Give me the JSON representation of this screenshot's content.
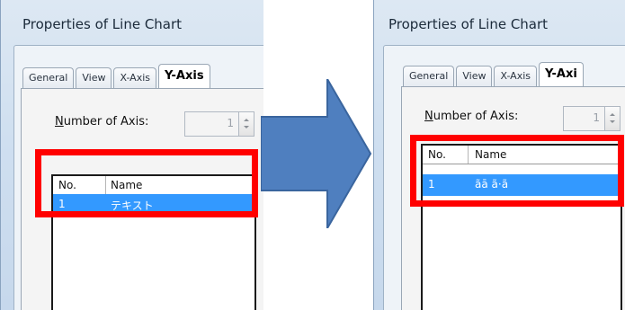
{
  "left_panel": {
    "title": "Properties of Line Chart",
    "tabs": [
      {
        "label": "General"
      },
      {
        "label": "View"
      },
      {
        "label": "X-Axis"
      },
      {
        "label": "Y-Axis"
      }
    ],
    "axis_label_prefix": "",
    "axis_label_mnemonic": "N",
    "axis_label_rest": "umber of Axis:",
    "axis_value": "1",
    "columns": {
      "no": "No.",
      "name": "Name"
    },
    "row": {
      "no": "1",
      "name": "テキスト"
    }
  },
  "right_panel": {
    "title": "Properties of Line Chart",
    "tabs": [
      {
        "label": "General"
      },
      {
        "label": "View"
      },
      {
        "label": "X-Axis"
      },
      {
        "label": "Y-Axi"
      }
    ],
    "axis_label_mnemonic": "N",
    "axis_label_rest": "umber of Axis:",
    "axis_value": "1",
    "columns": {
      "no": "No.",
      "name": "Name"
    },
    "row": {
      "no": "1",
      "name": "ãā ã·ã"
    }
  },
  "colors": {
    "highlight": "#ff0000",
    "selection": "#3399ff",
    "arrow": "#4f7fbf"
  }
}
